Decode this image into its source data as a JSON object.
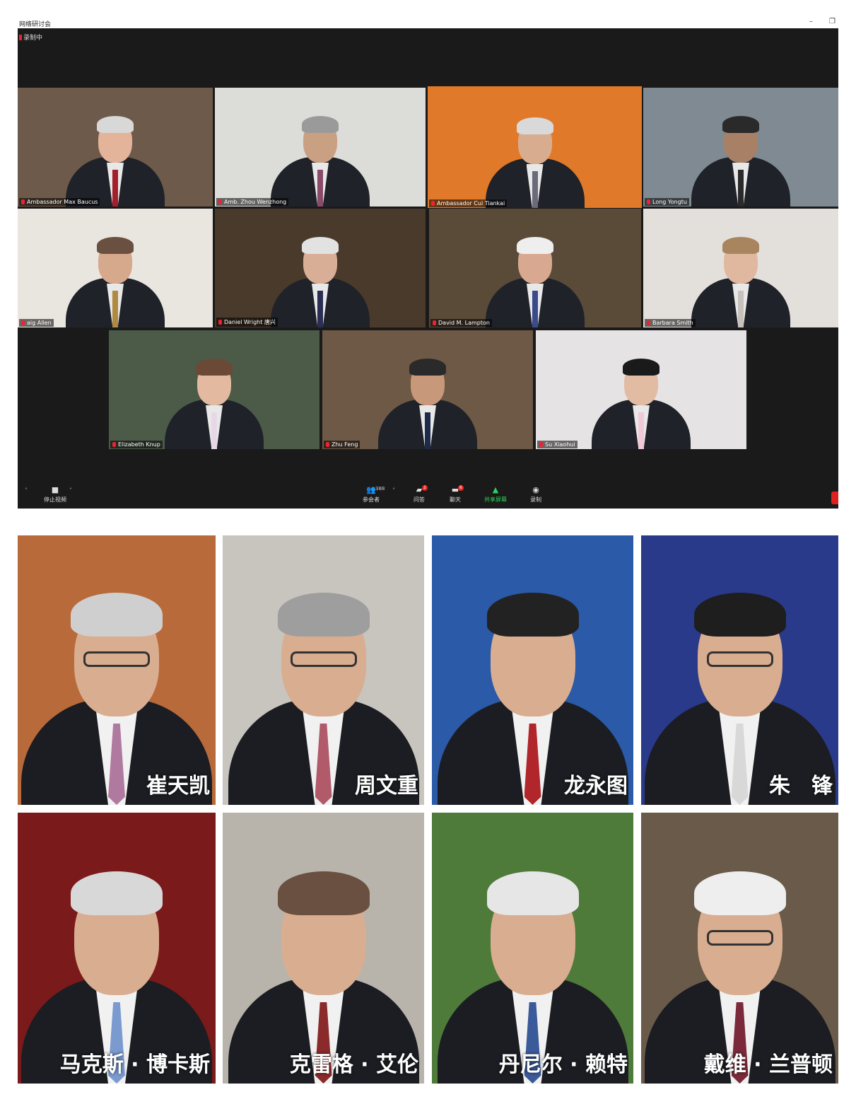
{
  "window": {
    "title": "网络研讨会",
    "recording_label": "录制中"
  },
  "participants": [
    {
      "name": "Ambassador Max Baucus",
      "bg": "#6e5a4a",
      "hair": "#d8d8d8",
      "tie": "#a31f2b",
      "skin": "#e3b39a"
    },
    {
      "name": "Amb. Zhou Wenzhong",
      "bg": "#dcdcd8",
      "hair": "#9a9a9a",
      "tie": "#8a4a6a",
      "skin": "#caa083"
    },
    {
      "name": "Ambassador Cui Tiankai",
      "bg": "#e07a2a",
      "hair": "#d9d9d9",
      "tie": "#6a6a7a",
      "skin": "#d8ad8f"
    },
    {
      "name": "Long Yongtu",
      "bg": "#7f8a92",
      "hair": "#2a2a2a",
      "tie": "#2a2a2a",
      "skin": "#a88066"
    },
    {
      "name": "aig Allen",
      "bg": "#e9e5df",
      "hair": "#6a5040",
      "tie": "#b08a40",
      "skin": "#d6a88c"
    },
    {
      "name": "Daniel Wright 唐兴",
      "bg": "#4a3a2c",
      "hair": "#e2e2e2",
      "tie": "#2a2e55",
      "skin": "#d9ae96"
    },
    {
      "name": "David M. Lampton",
      "bg": "#5a4a38",
      "hair": "#eeeeee",
      "tie": "#3a4a8a",
      "skin": "#d8a990"
    },
    {
      "name": "Barbara Smith",
      "bg": "#e3e0dc",
      "hair": "#a8855f",
      "tie": "#c8c0ba",
      "skin": "#e0b8a0"
    },
    {
      "name": "Elizabeth Knup",
      "bg": "#4c5a48",
      "hair": "#6a4a36",
      "tie": "#e8d8e6",
      "skin": "#e3b9a0"
    },
    {
      "name": "Zhu Feng",
      "bg": "#6e5846",
      "hair": "#2a2a2a",
      "tie": "#1e2a4a",
      "skin": "#c8987a"
    },
    {
      "name": "Su Xiaohui",
      "bg": "#e6e3e4",
      "hair": "#1a1a1a",
      "tie": "#f0c8d8",
      "skin": "#e2bba3"
    }
  ],
  "toolbar": {
    "stop_video": "停止视频",
    "participants": "参会者",
    "participant_count": "388",
    "qa": "问答",
    "qa_badge": "2",
    "chat": "聊天",
    "chat_badge": "6",
    "share_screen": "共享屏幕",
    "record": "录制"
  },
  "portraits": [
    {
      "name": "崔天凯",
      "bg": "#b86a3a",
      "tie": "#b07aa0",
      "hair": "#cfcfcf"
    },
    {
      "name": "周文重",
      "bg": "#c8c4be",
      "tie": "#b05a6a",
      "hair": "#9e9e9e"
    },
    {
      "name": "龙永图",
      "bg": "#2a5aa8",
      "tie": "#b0262a",
      "hair": "#222222"
    },
    {
      "name": "朱　锋",
      "bg": "#2a3a8a",
      "tie": "#d8d8d8",
      "hair": "#1e1e1e"
    },
    {
      "name": "马克斯 · 博卡斯",
      "bg": "#7a1a1a",
      "tie": "#7a9ad0",
      "hair": "#d8d8d8"
    },
    {
      "name": "克雷格 · 艾伦",
      "bg": "#b8b4ac",
      "tie": "#8a2a2a",
      "hair": "#6a5040"
    },
    {
      "name": "丹尼尔 · 赖特",
      "bg": "#4e7a3a",
      "tie": "#3a5a9a",
      "hair": "#e6e6e6"
    },
    {
      "name": "戴维 · 兰普顿",
      "bg": "#6a5a4a",
      "tie": "#7a2a3a",
      "hair": "#eeeeee"
    }
  ]
}
